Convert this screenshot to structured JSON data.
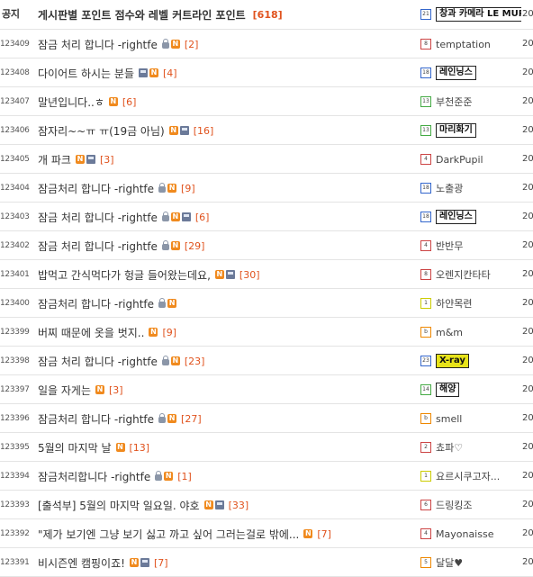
{
  "rows": [
    {
      "num": "공지",
      "title": "게시판별 포인트 점수와 레벨 커트라인 포인트",
      "icons": [],
      "comments": "[618]",
      "level": "21",
      "lvcolor": "blue",
      "author": "",
      "author_badge": "창과 카메라 LE MUP",
      "date": "20"
    },
    {
      "num": "123409",
      "title": "잠금 처리 합니다 -rightfe",
      "icons": [
        "lock",
        "new"
      ],
      "comments": "[2]",
      "level": "8",
      "lvcolor": "red",
      "author": "temptation",
      "author_badge": "",
      "date": "20"
    },
    {
      "num": "123408",
      "title": "다이어트 하시는 분들",
      "icons": [
        "img",
        "new"
      ],
      "comments": "[4]",
      "level": "18",
      "lvcolor": "blue",
      "author": "",
      "author_badge": "레인닝스",
      "date": "20"
    },
    {
      "num": "123407",
      "title": "말년입니다..ㅎ",
      "icons": [
        "new"
      ],
      "comments": "[6]",
      "level": "13",
      "lvcolor": "green",
      "author": "부천준준",
      "author_badge": "",
      "date": "20"
    },
    {
      "num": "123406",
      "title": "잠자리~~ㅠ ㅠ(19금 아님)",
      "icons": [
        "new",
        "img"
      ],
      "comments": "[16]",
      "level": "13",
      "lvcolor": "green",
      "author": "",
      "author_badge": "마리화기",
      "date": "20"
    },
    {
      "num": "123405",
      "title": "개 파크",
      "icons": [
        "new",
        "img"
      ],
      "comments": "[3]",
      "level": "4",
      "lvcolor": "red",
      "author": "DarkPupil",
      "author_badge": "",
      "date": "20"
    },
    {
      "num": "123404",
      "title": "잠금처리 합니다 -rightfe",
      "icons": [
        "lock",
        "new"
      ],
      "comments": "[9]",
      "level": "18",
      "lvcolor": "blue",
      "author": "노출광",
      "author_badge": "",
      "date": "20"
    },
    {
      "num": "123403",
      "title": "잠금 처리 합니다 -rightfe",
      "icons": [
        "lock",
        "new",
        "img"
      ],
      "comments": "[6]",
      "level": "18",
      "lvcolor": "blue",
      "author": "",
      "author_badge": "레인닝스",
      "date": "20"
    },
    {
      "num": "123402",
      "title": "잠금 처리 합니다 -rightfe",
      "icons": [
        "lock",
        "new"
      ],
      "comments": "[29]",
      "level": "4",
      "lvcolor": "red",
      "author": "반반무",
      "author_badge": "",
      "date": "20"
    },
    {
      "num": "123401",
      "title": "밥먹고 간식먹다가 헝글 들어왔는데요,",
      "icons": [
        "new",
        "img"
      ],
      "comments": "[30]",
      "level": "8",
      "lvcolor": "red",
      "author": "오렌지칸타타",
      "author_badge": "",
      "date": "20"
    },
    {
      "num": "123400",
      "title": "잠금처리 합니다 -rightfe",
      "icons": [
        "lock",
        "new"
      ],
      "comments": "",
      "level": "1",
      "lvcolor": "yellow",
      "author": "하얀목련",
      "author_badge": "",
      "date": "20"
    },
    {
      "num": "123399",
      "title": "버찌 때문에 옷을 벗지..",
      "icons": [
        "new"
      ],
      "comments": "[9]",
      "level": "b",
      "lvcolor": "orange",
      "author": "m&m",
      "author_badge": "",
      "date": "20"
    },
    {
      "num": "123398",
      "title": "잠금 처리 합니다 -rightfe",
      "icons": [
        "lock",
        "new"
      ],
      "comments": "[23]",
      "level": "23",
      "lvcolor": "blue",
      "author": "",
      "author_badge": "X-ray",
      "date": "20"
    },
    {
      "num": "123397",
      "title": "일을 자게는",
      "icons": [
        "new"
      ],
      "comments": "[3]",
      "level": "14",
      "lvcolor": "green",
      "author": "",
      "author_badge": "해양",
      "date": "20"
    },
    {
      "num": "123396",
      "title": "잠금처리 합니다 -rightfe",
      "icons": [
        "lock",
        "new"
      ],
      "comments": "[27]",
      "level": "b",
      "lvcolor": "orange",
      "author": "smell",
      "author_badge": "",
      "date": "20"
    },
    {
      "num": "123395",
      "title": "5월의 마지막 날",
      "icons": [
        "new"
      ],
      "comments": "[13]",
      "level": "2",
      "lvcolor": "red",
      "author": "쵸파♡",
      "author_badge": "",
      "date": "20"
    },
    {
      "num": "123394",
      "title": "잠금처리합니다 -rightfe",
      "icons": [
        "lock",
        "new"
      ],
      "comments": "[1]",
      "level": "1",
      "lvcolor": "yellow",
      "author": "요르시쿠고자...",
      "author_badge": "",
      "date": "20"
    },
    {
      "num": "123393",
      "title": "[출석부] 5월의 마지막 일요일. 야호",
      "icons": [
        "new",
        "img"
      ],
      "comments": "[33]",
      "level": "6",
      "lvcolor": "red",
      "author": "드링킹조",
      "author_badge": "",
      "date": "20"
    },
    {
      "num": "123392",
      "title": "\"제가 보기엔 그냥 보기 싫고 까고 싶어 그러는걸로 밖에...",
      "icons": [
        "new"
      ],
      "comments": "[7]",
      "level": "4",
      "lvcolor": "red",
      "author": "Mayonaisse",
      "author_badge": "",
      "date": "20"
    },
    {
      "num": "123391",
      "title": "비시즌엔 캠핑이죠!",
      "icons": [
        "new",
        "img"
      ],
      "comments": "[7]",
      "level": "5",
      "lvcolor": "orange",
      "author": "달달♥",
      "author_badge": "",
      "date": "20"
    }
  ]
}
